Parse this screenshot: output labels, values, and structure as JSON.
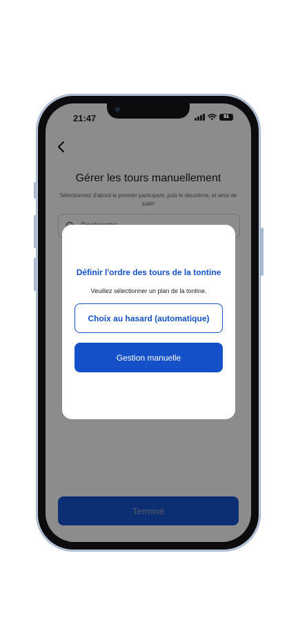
{
  "status_bar": {
    "time": "21:47",
    "battery": "51"
  },
  "page": {
    "title": "Gérer les tours manuellement",
    "subtitle": "Sélectionnez d'abord le premier participant, puis le deuxième, et ainsi de suite!",
    "search_placeholder": "Recherche",
    "done_label": "Terminé"
  },
  "modal": {
    "title": "Définir l'ordre des tours de la tontine",
    "description": "Veuillez sélectionner un plan de la tontine.",
    "random_label": "Choix au hasard (automatique)",
    "manual_label": "Gestion manuelle"
  },
  "colors": {
    "primary": "#1450c8",
    "overlay": "rgba(0,0,0,0.45)"
  }
}
